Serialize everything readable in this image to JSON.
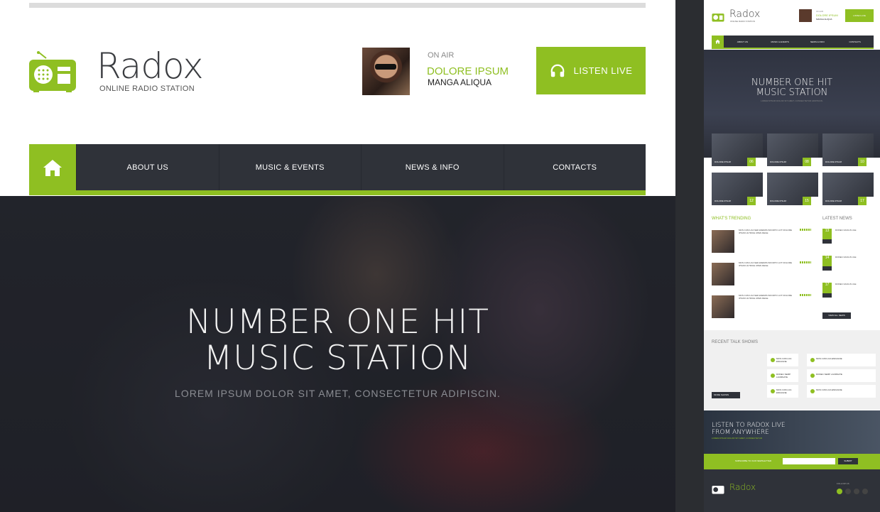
{
  "brand": {
    "name": "Radox",
    "tagline": "ONLINE RADIO STATION"
  },
  "on_air": {
    "label": "ON AIR",
    "host": "DOLORE IPSUM",
    "show": "MANGA ALIQUA"
  },
  "listen_button": {
    "label": "LISTEN LIVE"
  },
  "nav": {
    "items": [
      "ABOUT US",
      "MUSIC & EVENTS",
      "NEWS & INFO",
      "CONTACTS"
    ]
  },
  "hero": {
    "title_line1": "NUMBER ONE HIT",
    "title_line2": "MUSIC STATION",
    "subtitle": "LOREM IPSUM DOLOR SIT AMET, CONSECTETUR ADIPISCIN."
  },
  "colors": {
    "accent": "#8fbf22",
    "nav_bg": "#2f3239",
    "text_dark": "#3a3c40"
  },
  "thumbnail": {
    "tiles": [
      {
        "caption": "DOLORE IPSUM",
        "number": "06"
      },
      {
        "caption": "DOLORE IPSUM",
        "number": "08"
      },
      {
        "caption": "DOLORE IPSUM",
        "number": "10"
      },
      {
        "caption": "DOLORE IPSUM",
        "number": "12"
      },
      {
        "caption": "DOLORE IPSUM",
        "number": "15"
      },
      {
        "caption": "DOLORE IPSUM",
        "number": "17"
      }
    ],
    "trending_title": "WHAT'S TRENDING",
    "latest_title": "LATEST NEWS",
    "trending_items": [
      "MOS CUM LOA SED ENEMIS INKORTO LOT DOLORE IPSUM ULTRICE UPEN DEGE",
      "MOS CUM LOA SED ENEMIS INKORTO LOT DOLORE IPSUM ULTRICE UPEN DEGE",
      "MOS CUM LOA SED ENEMIS INKORTO LOT DOLORE IPSUM ULTRICE UPEN DEGE"
    ],
    "news_items": [
      {
        "day": "13",
        "title": "DONEC FACILIS ULE"
      },
      {
        "day": "14",
        "title": "DONEC FACILIS ULE"
      },
      {
        "day": "17",
        "title": "DONEC FACILIS ULE"
      }
    ],
    "view_all": "VIEW ALL NEWS",
    "talk_title": "RECENT TALK SHOWS",
    "talk_cards": [
      "MOS CUM LOA ENKAGNE",
      "MOS CUM LOA ENKAGNE",
      "DONEC SEMP LAORNATE",
      "DONEC SEMP LAORNATE",
      "MOS CUM LOA ENKAGNE",
      "MOS CUM LOA ENKAGNE"
    ],
    "more_shows": "MORE SHOWS",
    "promo_line1": "LISTEN TO RADOX LIVE",
    "promo_line2": "FROM ANYWHERE",
    "promo_sub": "LOREM IPSUM DOLOR SIT AMET, CONSECTETUR",
    "subscribe_text": "SUBSCRIBE TO OUR NEWSLETTER",
    "subscribe_btn": "SUBMIT",
    "follow": "FOLLOW US"
  }
}
